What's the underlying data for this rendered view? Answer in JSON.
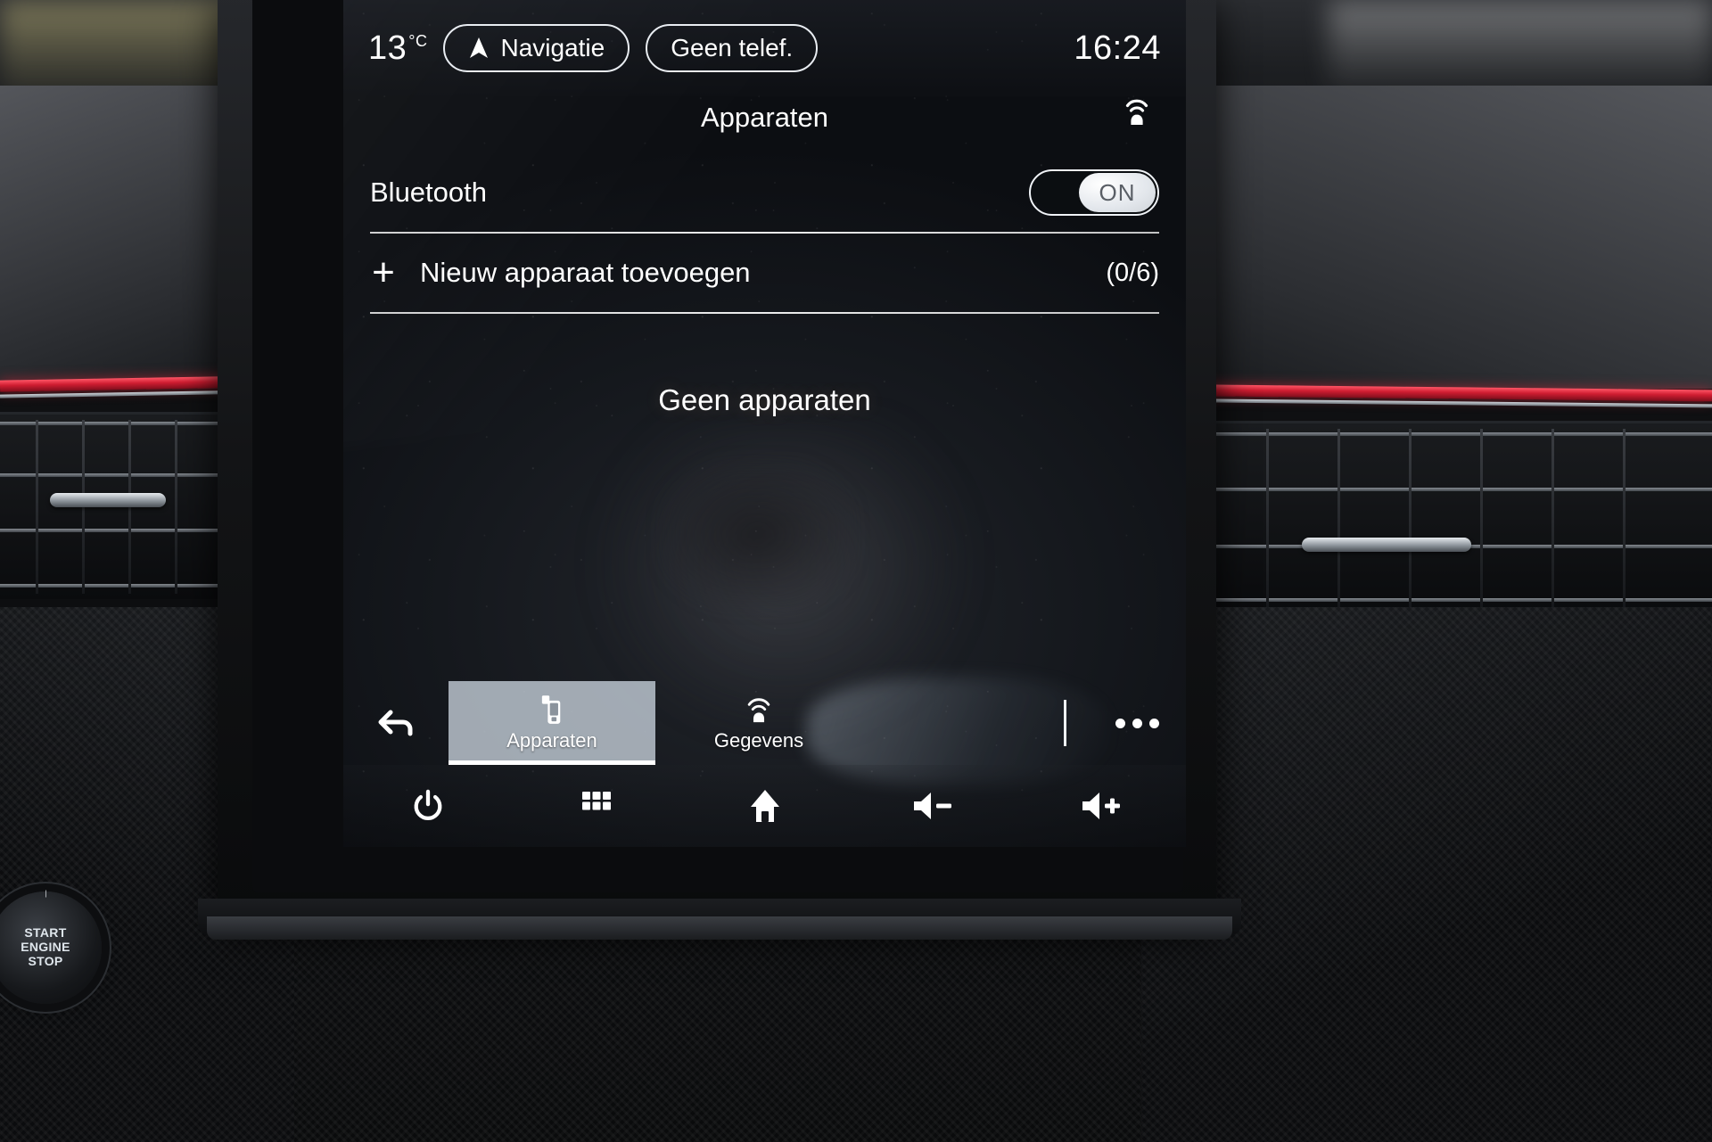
{
  "status_bar": {
    "temperature": "13",
    "temperature_unit": "°C",
    "navigation_label": "Navigatie",
    "navigation_icon": "navigation-arrow-icon",
    "phone_label": "Geen telef.",
    "clock": "16:24"
  },
  "header": {
    "title": "Apparaten",
    "connectivity_icon": "broadcast-icon"
  },
  "settings": {
    "bluetooth": {
      "label": "Bluetooth",
      "toggle_state": "ON"
    },
    "add_device": {
      "icon": "plus-icon",
      "label": "Nieuw apparaat toevoegen",
      "count": "(0/6)"
    }
  },
  "content": {
    "empty_message": "Geen apparaten"
  },
  "tab_bar": {
    "back_icon": "back-arrow-icon",
    "tabs": [
      {
        "label": "Apparaten",
        "icon": "device-phone-icon",
        "active": true
      },
      {
        "label": "Gegevens",
        "icon": "broadcast-icon",
        "active": false
      }
    ],
    "more_icon": "ellipsis-icon"
  },
  "key_bar": {
    "keys": [
      {
        "name": "power-icon",
        "label": "Power"
      },
      {
        "name": "apps-grid-icon",
        "label": "Apps"
      },
      {
        "name": "home-icon",
        "label": "Home"
      },
      {
        "name": "volume-down-icon",
        "label": "Volume down"
      },
      {
        "name": "volume-up-icon",
        "label": "Volume up"
      }
    ]
  },
  "dashboard": {
    "start_button": {
      "line1": "START",
      "line2": "ENGINE",
      "line3": "STOP"
    }
  },
  "colors": {
    "screen_background": "#15181d",
    "accent_red": "#cf1d31",
    "text_primary": "#ffffff",
    "tab_active_background": "#c4ced8"
  }
}
